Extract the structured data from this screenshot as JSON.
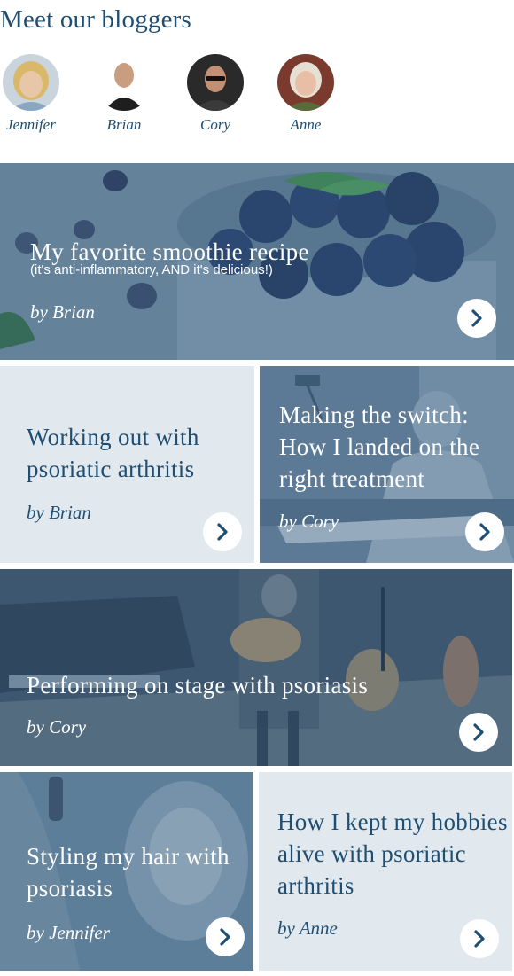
{
  "heading": "Meet our bloggers",
  "bloggers": [
    {
      "name": "Jennifer"
    },
    {
      "name": "Brian"
    },
    {
      "name": "Cory"
    },
    {
      "name": "Anne"
    }
  ],
  "cards": [
    {
      "title": "My favorite smoothie recipe",
      "subtitle": "(it's anti-inflammatory, AND it's delicious!)",
      "author": "by Brian"
    },
    {
      "title": "Working out with psoriatic arthritis",
      "author": "by Brian"
    },
    {
      "title": "Making the switch: How I landed on the right treatment",
      "author": "by Cory"
    },
    {
      "title": "Performing on stage with psoriasis",
      "author": "by Cory"
    },
    {
      "title": "Styling my hair with psoriasis",
      "author": "by Jennifer"
    },
    {
      "title": "How I kept my hobbies alive with psoriatic arthritis",
      "author": "by Anne"
    }
  ],
  "colors": {
    "navy": "#1f4e73",
    "light_panel": "#e2e9ee",
    "overlay": "#3e6280"
  },
  "icons": {
    "card_arrow": "chevron-right-icon"
  }
}
